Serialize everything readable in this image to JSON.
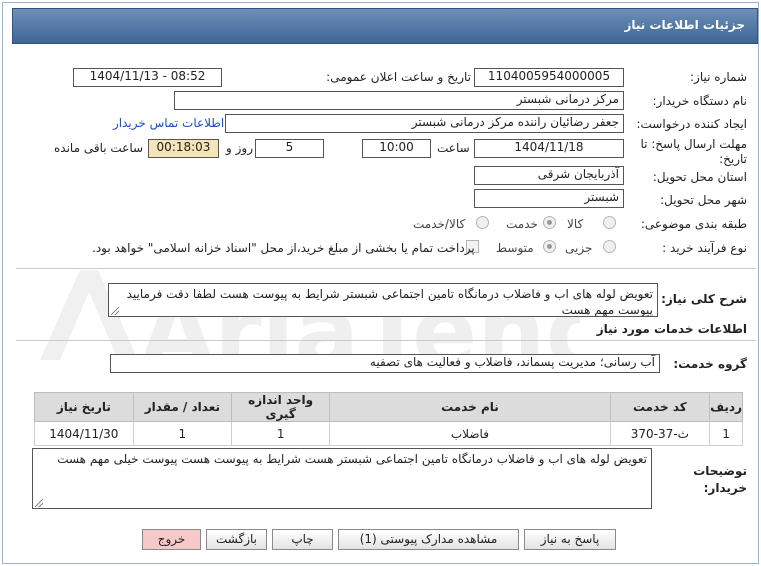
{
  "header": {
    "title": "جزئیات اطلاعات نیاز"
  },
  "fields": {
    "need_number_label": "شماره نیاز:",
    "need_number": "1104005954000005",
    "announce_label": "تاریخ و ساعت اعلان عمومی:",
    "announce_value": "1404/11/13 - 08:52",
    "buyer_org_label": "نام دستگاه خریدار:",
    "buyer_org": "مرکز درمانی شبستر",
    "requester_label": "ایجاد کننده درخواست:",
    "requester": "جعفر رضائیان راننده مرکز درمانی شبستر",
    "contact_link": "اطلاعات تماس خریدار",
    "deadline_label": "مهلت ارسال پاسخ: تا تاریخ:",
    "deadline_date": "1404/11/18",
    "time_label": "ساعت",
    "deadline_time": "10:00",
    "days_value": "5",
    "days_label": "روز و",
    "remaining_value": "00:18:03",
    "remaining_label": "ساعت باقی مانده",
    "province_label": "استان محل تحویل:",
    "province": "آذربایجان شرقی",
    "city_label": "شهر محل تحویل:",
    "city": "شبستر",
    "category_label": "طبقه بندی موضوعی:",
    "category_options": [
      "کالا",
      "خدمت",
      "کالا/خدمت"
    ],
    "category_selected": "خدمت",
    "process_label": "نوع فرآیند خرید :",
    "process_options": [
      "جزیی",
      "متوسط"
    ],
    "process_selected": "جزیی",
    "treasury_text": "پرداخت تمام یا بخشی از مبلغ خرید،از محل \"اسناد خزانه اسلامی\" خواهد بود."
  },
  "description": {
    "label": "شرح کلی نیاز:",
    "text": "تعویض لوله های اب و فاضلاب درمانگاه تامین اجتماعی شبستر شرایط به پیوست هست لطفا دقت فرمایید پیوست مهم هست"
  },
  "services_section": {
    "heading": "اطلاعات خدمات مورد نیاز",
    "group_label": "گروه خدمت:",
    "group_value": "آب رسانی؛ مدیریت پسماند، فاضلاب و فعالیت های تصفیه"
  },
  "table": {
    "headers": [
      "ردیف",
      "کد خدمت",
      "نام خدمت",
      "واحد اندازه گیری",
      "تعداد / مقدار",
      "تاریخ نیاز"
    ],
    "rows": [
      [
        "1",
        "ث-37-370",
        "فاضلاب",
        "1",
        "1",
        "1404/11/30"
      ]
    ]
  },
  "buyer_notes": {
    "label": "توضیحات خریدار:",
    "text": "تعویض لوله های اب و فاضلاب درمانگاه تامین اجتماعی شبستر هست شرایط به پیوست هست پیوست خیلی مهم هست"
  },
  "buttons": {
    "reply": "پاسخ به نیاز",
    "attachments": "مشاهده مدارک پیوستی (1)",
    "print": "چاپ",
    "back": "بازگشت",
    "exit": "خروج"
  },
  "watermark": "AriaTender.net",
  "colors": {
    "title_bar": "#3f6696",
    "remaining_bg": "#f4e4b8",
    "link": "#1f4fbf",
    "exit_btn": "#f6c9c9"
  }
}
